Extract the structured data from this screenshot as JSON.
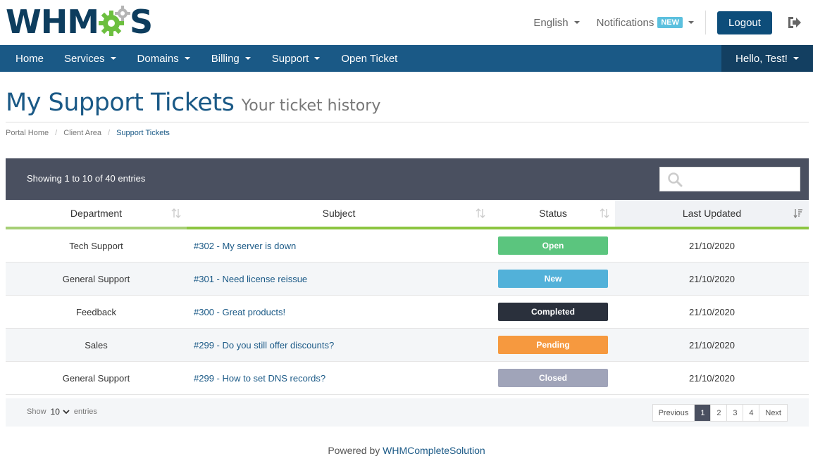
{
  "header": {
    "logo_left": "WHM",
    "logo_right": "S",
    "language": "English",
    "notifications": "Notifications",
    "notifications_badge": "NEW",
    "logout": "Logout"
  },
  "nav": {
    "items": [
      {
        "label": "Home"
      },
      {
        "label": "Services"
      },
      {
        "label": "Domains"
      },
      {
        "label": "Billing"
      },
      {
        "label": "Support"
      },
      {
        "label": "Open Ticket"
      }
    ],
    "user": "Hello, Test!"
  },
  "page": {
    "title": "My Support Tickets",
    "subtitle": "Your ticket history"
  },
  "breadcrumb": [
    "Portal Home",
    "Client Area",
    "Support Tickets"
  ],
  "table": {
    "showing": "Showing 1 to 10 of 40 entries",
    "search_placeholder": "",
    "columns": [
      "Department",
      "Subject",
      "Status",
      "Last Updated"
    ],
    "rows": [
      {
        "department": "Tech Support",
        "subject": "#302 - My server is down",
        "status": "Open",
        "status_color": "#5bc57e",
        "updated": "21/10/2020"
      },
      {
        "department": "General Support",
        "subject": "#301 - Need license reissue",
        "status": "New",
        "status_color": "#52b1d9",
        "updated": "21/10/2020"
      },
      {
        "department": "Feedback",
        "subject": "#300 - Great products!",
        "status": "Completed",
        "status_color": "#2a303c",
        "updated": "21/10/2020"
      },
      {
        "department": "Sales",
        "subject": "#299 - Do you still offer discounts?",
        "status": "Pending",
        "status_color": "#f6993f",
        "updated": "21/10/2020"
      },
      {
        "department": "General Support",
        "subject": "#299 - How to set DNS records?",
        "status": "Closed",
        "status_color": "#a0a4b9",
        "updated": "21/10/2020"
      }
    ],
    "footer": {
      "show": "Show",
      "entries_value": "10",
      "entries": "entries",
      "previous": "Previous",
      "pages": [
        "1",
        "2",
        "3",
        "4"
      ],
      "next": "Next"
    }
  },
  "footer": {
    "powered_by": "Powered by",
    "link": "WHMCompleteSolution"
  },
  "colors": {
    "brand": "#0d3d5e",
    "nav": "#1a5986",
    "accent_green": "#8cc541"
  }
}
